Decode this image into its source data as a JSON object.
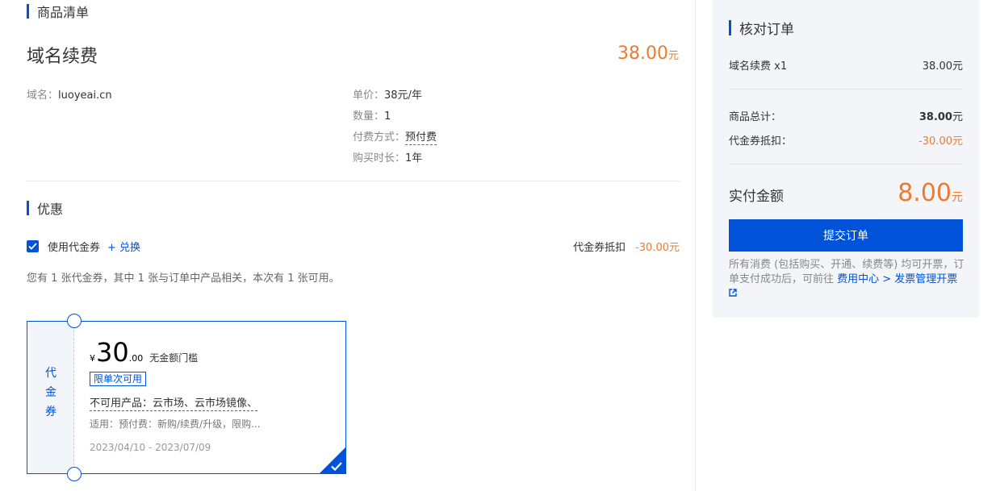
{
  "colors": {
    "accent": "#0052d9",
    "price": "#ed7b2f"
  },
  "goods": {
    "section_title": "商品清单",
    "product_name": "域名续费",
    "price_value": "38.00",
    "price_unit": "元",
    "domain_label": "域名：",
    "domain_value": "luoyeai.cn",
    "unit_price_label": "单价：",
    "unit_price_value": "38元/年",
    "quantity_label": "数量：",
    "quantity_value": "1",
    "pay_method_label": "付费方式：",
    "pay_method_value": "预付费",
    "duration_label": "购买时长：",
    "duration_value": "1年"
  },
  "discount": {
    "section_title": "优惠",
    "use_coupon_label": "使用代金券",
    "use_coupon_checked": true,
    "exchange_link": "+ 兑换",
    "deduct_label": "代金券抵扣",
    "deduct_value": "-30.00元",
    "summary": "您有 1 张代金券，其中 1 张与订单中产品相关，本次有 1 张可用。",
    "coupon": {
      "stub_label": "代\n金\n券",
      "yen": "¥",
      "amount": "30",
      "cents": ".00",
      "threshold": "无金额门槛",
      "tag": "限单次可用",
      "unavailable": "不可用产品：云市场、云市场镜像、",
      "applicable": "适用：预付费：新购/续费/升级，限购...",
      "dates": "2023/04/10 - 2023/07/09",
      "selected": true,
      "check_icon": "check-icon"
    }
  },
  "order": {
    "title": "核对订单",
    "item_label": "域名续费 x1",
    "item_value": "38.00元",
    "total_label": "商品总计：",
    "total_value": "38.00",
    "total_unit": "元",
    "coupon_label": "代金券抵扣：",
    "coupon_value": "-30.00元",
    "pay_label": "实付金额",
    "pay_value": "8.00",
    "pay_unit": "元",
    "submit_label": "提交订单",
    "invoice_text": "所有消费 (包括购买、开通、续费等) 均可开票，订单支付成功后，可前往 ",
    "invoice_link": "费用中心 > 发票管理开票",
    "external_icon": "external-link-icon"
  }
}
